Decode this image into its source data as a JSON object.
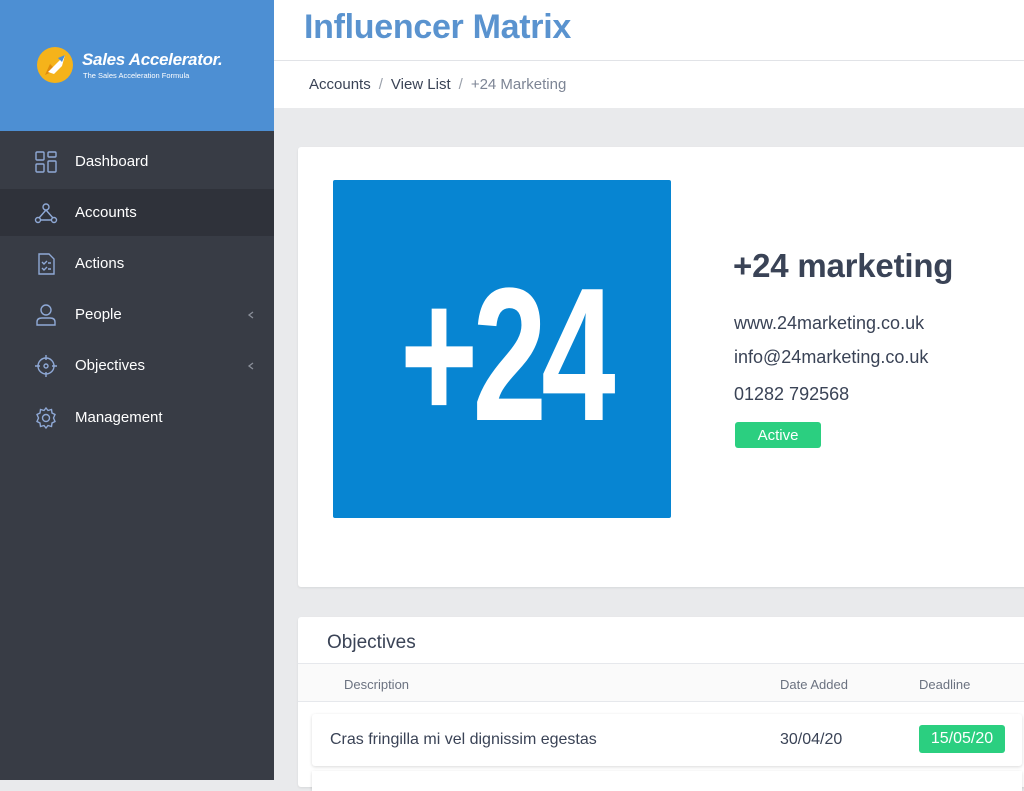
{
  "brand": {
    "name": "Sales Accelerator.",
    "tagline": "The Sales Acceleration Formula"
  },
  "sidebar": {
    "items": [
      {
        "label": "Dashboard",
        "icon": "dashboard-icon",
        "active": false,
        "has_submenu": false
      },
      {
        "label": "Accounts",
        "icon": "accounts-icon",
        "active": true,
        "has_submenu": false
      },
      {
        "label": "Actions",
        "icon": "checklist-icon",
        "active": false,
        "has_submenu": false
      },
      {
        "label": "People",
        "icon": "person-icon",
        "active": false,
        "has_submenu": true
      },
      {
        "label": "Objectives",
        "icon": "target-icon",
        "active": false,
        "has_submenu": true
      },
      {
        "label": "Management",
        "icon": "gear-icon",
        "active": false,
        "has_submenu": false
      }
    ]
  },
  "header": {
    "title": "Influencer Matrix"
  },
  "breadcrumb": {
    "items": [
      "Accounts",
      "View List",
      "+24 Marketing"
    ],
    "separator": "/"
  },
  "account": {
    "logo_text": "+24",
    "name": "+24 marketing",
    "website": "www.24marketing.co.uk",
    "email": "info@24marketing.co.uk",
    "phone": "01282 792568",
    "status": "Active"
  },
  "objectives": {
    "title": "Objectives",
    "columns": [
      "Description",
      "Date Added",
      "Deadline"
    ],
    "rows": [
      {
        "description": "Cras fringilla mi vel dignissim egestas",
        "date_added": "30/04/20",
        "deadline": "15/05/20"
      }
    ]
  },
  "colors": {
    "brand_blue": "#4d8fd3",
    "sidebar_bg": "#383c45",
    "logo_tile": "#0785d2",
    "status_green": "#2bcf80",
    "title_blue": "#5a93cf"
  }
}
